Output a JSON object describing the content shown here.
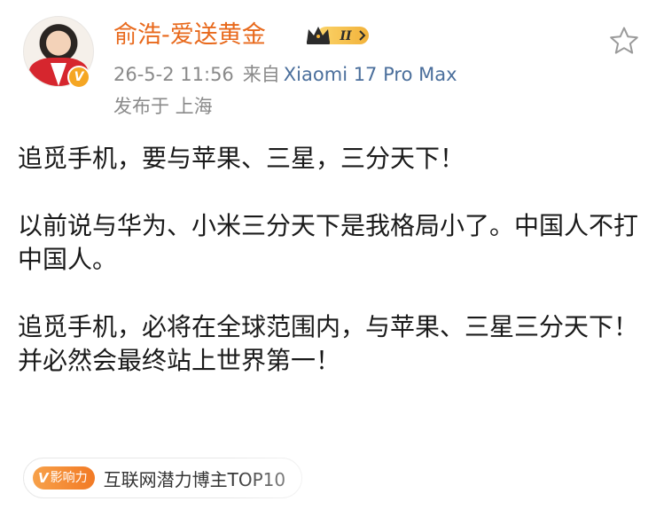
{
  "post": {
    "author": {
      "name": "俞浩-爱送黄金",
      "level_badge": "II",
      "verified_icon": "v-badge-icon",
      "avatar_icon": "avatar"
    },
    "meta": {
      "timestamp": "26-5-2 11:56",
      "source_prefix": "来自",
      "device": "Xiaomi 17 Pro Max",
      "location": "发布于 上海"
    },
    "actions": {
      "favorite_icon": "star-outline-icon"
    },
    "body": {
      "p1": "追觅手机，要与苹果、三星，三分天下！",
      "p2": "以前说与华为、小米三分天下是我格局小了。中国人不打中国人。",
      "p3": "追觅手机，必将在全球范围内，与苹果、三星三分天下！",
      "p4": "并必然会最终站上世界第一！"
    },
    "tag": {
      "pill_v": "V",
      "pill_label": "影响力",
      "text": "互联网潜力博主TOP10"
    }
  },
  "colors": {
    "username": "#e8691c",
    "device_link": "#4b6f9c",
    "meta_gray": "#8a8a8a",
    "badge_orange": "#f5a623"
  }
}
